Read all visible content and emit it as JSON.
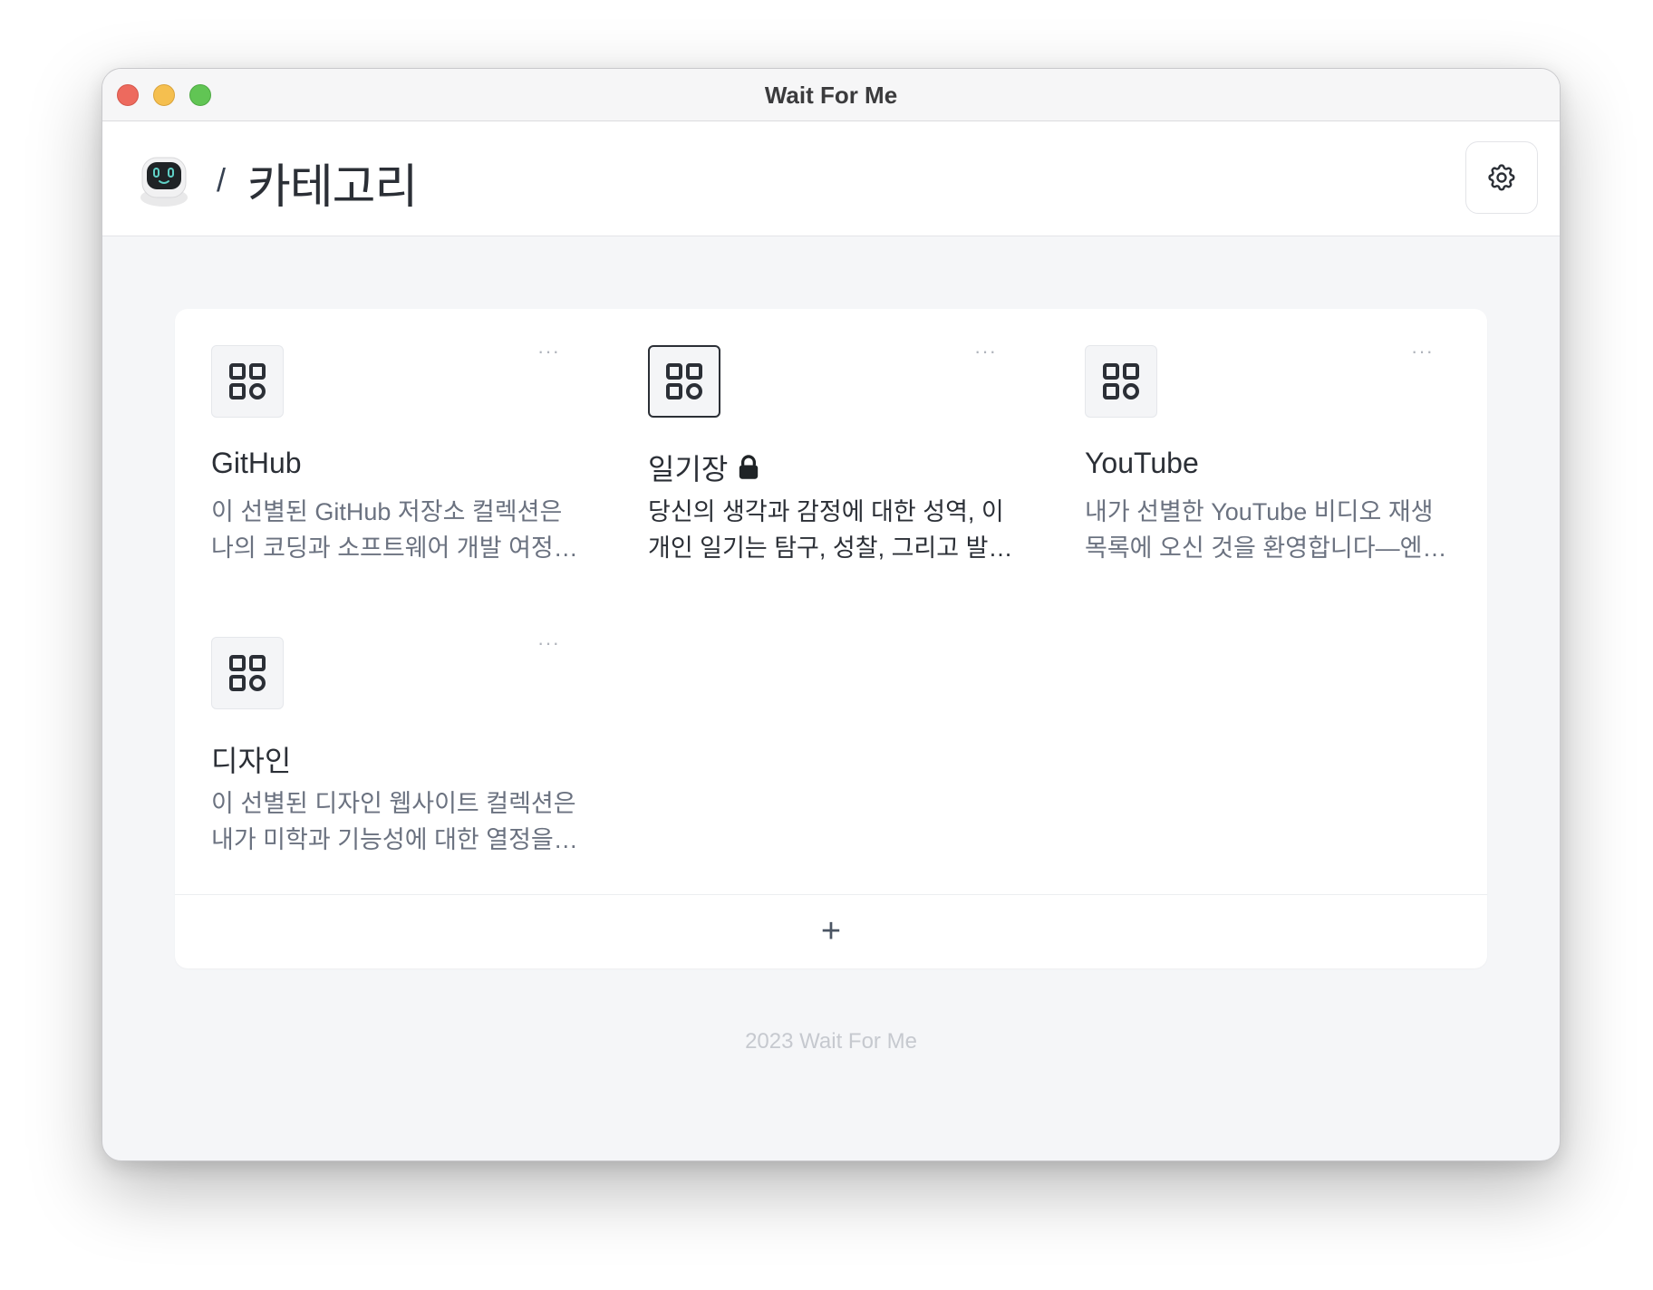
{
  "window": {
    "title": "Wait For Me"
  },
  "header": {
    "breadcrumb_separator": "/",
    "page_title": "카테고리",
    "settings_icon": "gear-icon"
  },
  "categories": [
    {
      "title": "GitHub",
      "description": "이 선별된 GitHub 저장소 컬렉션은 나의 코딩과 소프트웨어 개발 여정을 보여줍니다",
      "icon": "grid-icon",
      "locked": false,
      "menu_label": "···"
    },
    {
      "title": "일기장",
      "description": "당신의 생각과 감정에 대한 성역, 이 개인 일기는 탐구, 성찰, 그리고 발견을 위한 공간입니다",
      "icon": "grid-icon",
      "locked": true,
      "menu_label": "···"
    },
    {
      "title": "YouTube",
      "description": "내가 선별한 YouTube 비디오 재생 목록에 오신 것을 환영합니다—엔터테인먼트와 배움의 공간",
      "icon": "grid-icon",
      "locked": false,
      "menu_label": "···"
    },
    {
      "title": "디자인",
      "description": "이 선별된 디자인 웹사이트 컬렉션은 내가 미학과 기능성에 대한 열정을 보여줍니다",
      "icon": "grid-icon",
      "locked": false,
      "menu_label": "···"
    }
  ],
  "add_button": {
    "label": "+"
  },
  "footer": {
    "text": "2023 Wait For Me"
  },
  "colors": {
    "accent": "#2b2f36",
    "muted_text": "#6b7280",
    "background": "#f5f6f8"
  }
}
